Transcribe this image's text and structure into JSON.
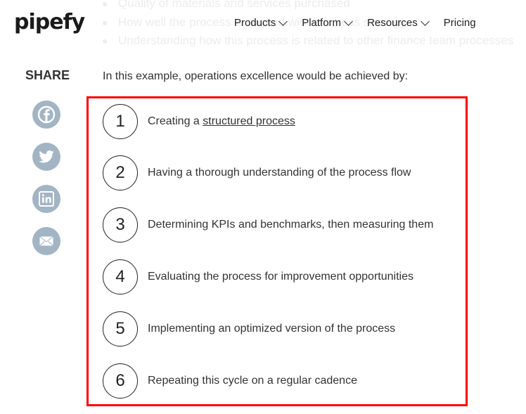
{
  "background_list": [
    "Quality of materials and services purchased",
    "How well the process is aligned with business strategy",
    "Understanding how this process is related to other finance team processes"
  ],
  "header": {
    "logo": "pipefy",
    "nav": [
      {
        "label": "Products",
        "dropdown": true
      },
      {
        "label": "Platform",
        "dropdown": true
      },
      {
        "label": "Resources",
        "dropdown": true
      },
      {
        "label": "Pricing",
        "dropdown": false
      }
    ]
  },
  "share": {
    "label": "SHARE",
    "icons": [
      "facebook-icon",
      "twitter-icon",
      "linkedin-icon",
      "email-icon"
    ],
    "color": "#a3b5c4"
  },
  "content": {
    "intro": "In this example, operations excellence would be achieved by:",
    "highlight_color": "#ff0000",
    "steps": [
      {
        "num": "1",
        "prefix": "Creating a ",
        "link": "structured process"
      },
      {
        "num": "2",
        "text": "Having a thorough understanding of the process flow"
      },
      {
        "num": "3",
        "text": "Determining KPIs and benchmarks, then measuring them"
      },
      {
        "num": "4",
        "text": "Evaluating the process for improvement opportunities"
      },
      {
        "num": "5",
        "text": "Implementing an optimized version of the process"
      },
      {
        "num": "6",
        "text": "Repeating this cycle on a regular cadence"
      }
    ]
  }
}
